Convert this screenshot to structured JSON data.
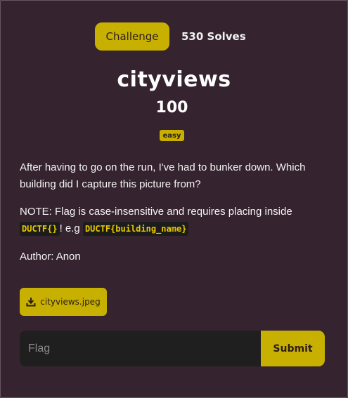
{
  "tabs": {
    "challenge_label": "Challenge",
    "solves_label": "530 Solves"
  },
  "challenge": {
    "name": "cityviews",
    "points": "100",
    "difficulty": "easy",
    "description_1": "After having to go on the run, I've had to bunker down. Which building did I capture this picture from?",
    "note_prefix": "NOTE: Flag is case-insensitive and requires placing inside",
    "note_code_1": "DUCTF{}",
    "note_mid": "! e.g",
    "note_code_2": "DUCTF{building_name}",
    "author": "Author: Anon"
  },
  "files": {
    "download_label": "cityviews.jpeg",
    "icon": "download-icon"
  },
  "flag_form": {
    "placeholder": "Flag",
    "value": "",
    "submit_label": "Submit"
  },
  "colors": {
    "background": "#35232f",
    "accent": "#c8b000",
    "input_bg": "#1f1f1f",
    "code_text": "#e8c900"
  }
}
